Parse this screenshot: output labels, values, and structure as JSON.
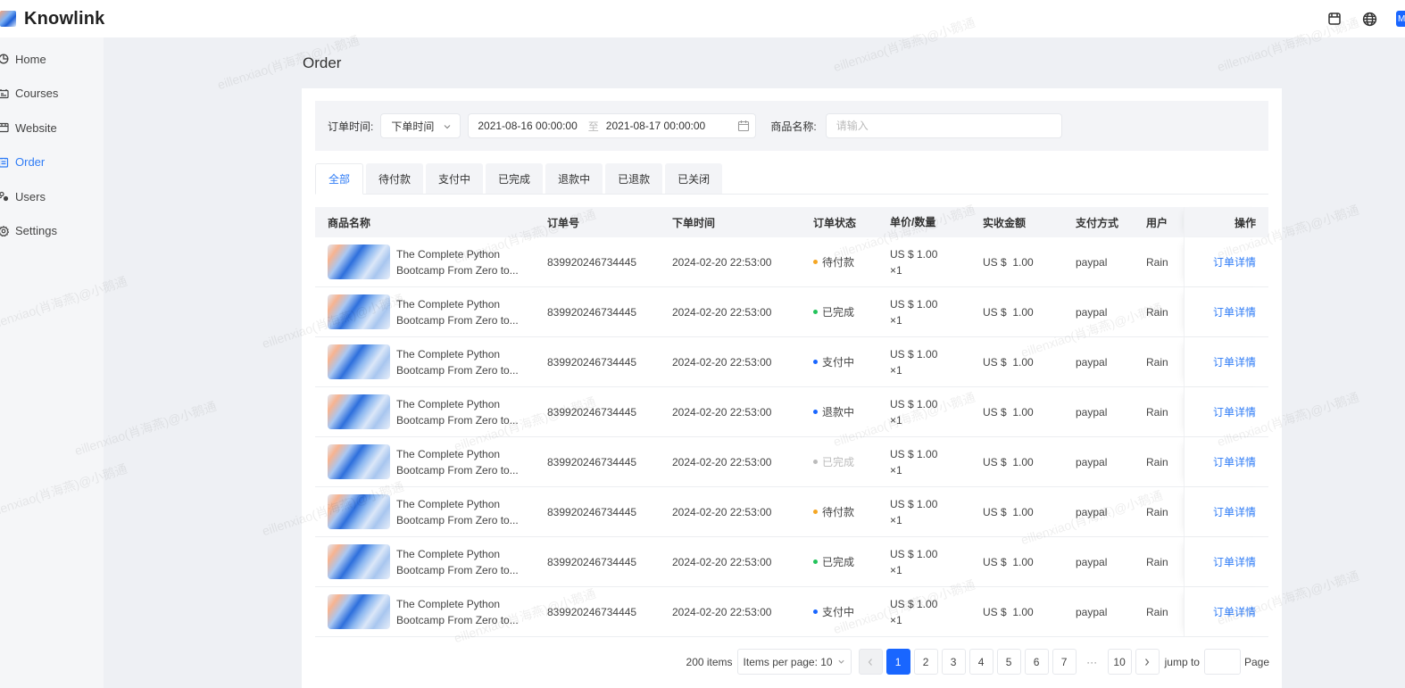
{
  "app": {
    "logo_text": "Knowlink",
    "avatar_initial": "M"
  },
  "topbar": {
    "icons": [
      "store-icon",
      "globe-icon"
    ]
  },
  "sidebar": {
    "items": [
      {
        "label": "Home",
        "icon": "home-icon",
        "active": false
      },
      {
        "label": "Courses",
        "icon": "courses-icon",
        "active": false
      },
      {
        "label": "Website",
        "icon": "website-icon",
        "active": false
      },
      {
        "label": "Order",
        "icon": "order-icon",
        "active": true
      },
      {
        "label": "Users",
        "icon": "users-icon",
        "active": false
      },
      {
        "label": "Settings",
        "icon": "settings-icon",
        "active": false
      }
    ]
  },
  "page": {
    "title": "Order"
  },
  "filter": {
    "time_label": "订单时间:",
    "time_type_value": "下单时间",
    "date_start": "2021-08-16 00:00:00",
    "date_separator": "至",
    "date_end": "2021-08-17 00:00:00",
    "product_label": "商品名称:",
    "product_value": "",
    "product_placeholder": "请输入"
  },
  "tabs": [
    {
      "label": "全部",
      "active": true
    },
    {
      "label": "待付款",
      "active": false
    },
    {
      "label": "支付中",
      "active": false
    },
    {
      "label": "已完成",
      "active": false
    },
    {
      "label": "退款中",
      "active": false
    },
    {
      "label": "已退款",
      "active": false
    },
    {
      "label": "已关闭",
      "active": false
    }
  ],
  "table": {
    "columns": [
      "商品名称",
      "订单号",
      "下单时间",
      "订单状态",
      "单价/数量",
      "实收金额",
      "支付方式",
      "用户",
      "操作"
    ],
    "rows": [
      {
        "name_line1": "The Complete Python",
        "name_line2": "Bootcamp From Zero to...",
        "order_no": "839920246734445",
        "time": "2024-02-20 22:53:00",
        "status": "待付款",
        "status_color": "#f5a623",
        "muted": false,
        "price": "US $ 1.00",
        "qty": "×1",
        "paid": "US $  1.00",
        "method": "paypal",
        "user": "Rain",
        "action": "订单详情"
      },
      {
        "name_line1": "The Complete Python",
        "name_line2": "Bootcamp From Zero to...",
        "order_no": "839920246734445",
        "time": "2024-02-20 22:53:00",
        "status": "已完成",
        "status_color": "#23c35b",
        "muted": false,
        "price": "US $ 1.00",
        "qty": "×1",
        "paid": "US $  1.00",
        "method": "paypal",
        "user": "Rain",
        "action": "订单详情"
      },
      {
        "name_line1": "The Complete Python",
        "name_line2": "Bootcamp From Zero to...",
        "order_no": "839920246734445",
        "time": "2024-02-20 22:53:00",
        "status": "支付中",
        "status_color": "#1966ff",
        "muted": false,
        "price": "US $ 1.00",
        "qty": "×1",
        "paid": "US $  1.00",
        "method": "paypal",
        "user": "Rain",
        "action": "订单详情"
      },
      {
        "name_line1": "The Complete Python",
        "name_line2": "Bootcamp From Zero to...",
        "order_no": "839920246734445",
        "time": "2024-02-20 22:53:00",
        "status": "退款中",
        "status_color": "#1966ff",
        "muted": false,
        "price": "US $ 1.00",
        "qty": "×1",
        "paid": "US $  1.00",
        "method": "paypal",
        "user": "Rain",
        "action": "订单详情"
      },
      {
        "name_line1": "The Complete Python",
        "name_line2": "Bootcamp From Zero to...",
        "order_no": "839920246734445",
        "time": "2024-02-20 22:53:00",
        "status": "已完成",
        "status_color": "#bbbbbb",
        "muted": true,
        "price": "US $ 1.00",
        "qty": "×1",
        "paid": "US $  1.00",
        "method": "paypal",
        "user": "Rain",
        "action": "订单详情"
      },
      {
        "name_line1": "The Complete Python",
        "name_line2": "Bootcamp From Zero to...",
        "order_no": "839920246734445",
        "time": "2024-02-20 22:53:00",
        "status": "待付款",
        "status_color": "#f5a623",
        "muted": false,
        "price": "US $ 1.00",
        "qty": "×1",
        "paid": "US $  1.00",
        "method": "paypal",
        "user": "Rain",
        "action": "订单详情"
      },
      {
        "name_line1": "The Complete Python",
        "name_line2": "Bootcamp From Zero to...",
        "order_no": "839920246734445",
        "time": "2024-02-20 22:53:00",
        "status": "已完成",
        "status_color": "#23c35b",
        "muted": false,
        "price": "US $ 1.00",
        "qty": "×1",
        "paid": "US $  1.00",
        "method": "paypal",
        "user": "Rain",
        "action": "订单详情"
      },
      {
        "name_line1": "The Complete Python",
        "name_line2": "Bootcamp From Zero to...",
        "order_no": "839920246734445",
        "time": "2024-02-20 22:53:00",
        "status": "支付中",
        "status_color": "#1966ff",
        "muted": false,
        "price": "US $ 1.00",
        "qty": "×1",
        "paid": "US $  1.00",
        "method": "paypal",
        "user": "Rain",
        "action": "订单详情"
      }
    ]
  },
  "pagination": {
    "total": "200 items",
    "page_size": "Items per page: 10",
    "pages": [
      "1",
      "2",
      "3",
      "4",
      "5",
      "6",
      "7"
    ],
    "ellipsis": "···",
    "last_page": "10",
    "current_page": "1",
    "jump_label": "jump to",
    "jump_value": "",
    "page_label": "Page"
  },
  "watermark": "eillenxiao(肖海燕)@小鹅通",
  "colors": {
    "accent": "#1966ff",
    "link": "#2f7cf6"
  }
}
